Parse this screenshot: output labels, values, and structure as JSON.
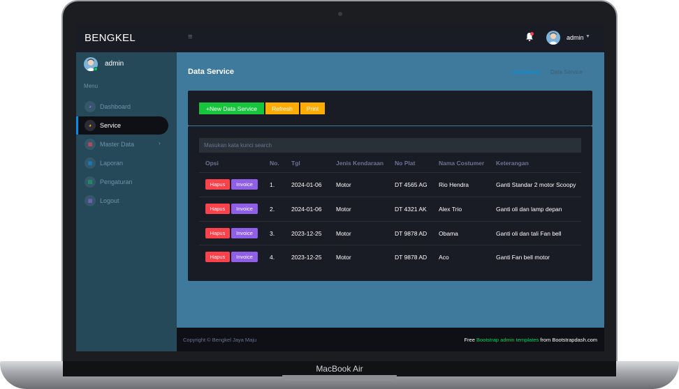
{
  "device": {
    "label": "MacBook Air"
  },
  "topbar": {
    "brand": "BENGKEL",
    "menu_icon": "hamburger-icon",
    "user": "admin"
  },
  "sidebar": {
    "user": "admin",
    "menu_title": "Menu",
    "items": [
      {
        "label": "Dashboard",
        "icon": "speedometer-icon",
        "color": "#8f5fe8"
      },
      {
        "label": "Service",
        "icon": "gauge-icon",
        "color": "#ffab00",
        "active": true
      },
      {
        "label": "Master Data",
        "icon": "laptop-icon",
        "color": "#fc424a"
      },
      {
        "label": "Laporan",
        "icon": "table-icon",
        "color": "#0090e7"
      },
      {
        "label": "Pengaturan",
        "icon": "chart-icon",
        "color": "#00d25b"
      },
      {
        "label": "Logout",
        "icon": "logout-icon",
        "color": "#8f5fe8"
      }
    ]
  },
  "page": {
    "title": "Data Service",
    "breadcrumb": [
      "Dashboard",
      "Data Service"
    ]
  },
  "toolbar": {
    "new": "+New Data Service",
    "refresh": "Refresh",
    "print": "Print"
  },
  "search": {
    "placeholder": "Masukan kata kunci search"
  },
  "table": {
    "headers": [
      "Opsi",
      "No.",
      "Tgl",
      "Jenis Kendaraan",
      "No Plat",
      "Nama Costumer",
      "Keterangan"
    ],
    "action_labels": {
      "hapus": "Hapus",
      "invoice": "Invoice"
    },
    "rows": [
      {
        "no": "1.",
        "tgl": "2024-01-06",
        "jenis": "Motor",
        "plat": "DT 4565 AG",
        "nama": "Rio Hendra",
        "ket": "Ganti Standar 2 motor Scoopy"
      },
      {
        "no": "2.",
        "tgl": "2024-01-06",
        "jenis": "Motor",
        "plat": "DT 4321 AK",
        "nama": "Alex Trio",
        "ket": "Ganti oli dan lamp depan"
      },
      {
        "no": "3.",
        "tgl": "2023-12-25",
        "jenis": "Motor",
        "plat": "DT 9878 AD",
        "nama": "Obama",
        "ket": "Ganti oli dan tali Fan bell"
      },
      {
        "no": "4.",
        "tgl": "2023-12-25",
        "jenis": "Motor",
        "plat": "DT 9878 AD",
        "nama": "Aco",
        "ket": "Ganti Fan bell motor"
      }
    ]
  },
  "footer": {
    "copyright": "Copyright © Bengkel Jaya Maju",
    "free_prefix": "Free ",
    "free_link": "Bootstrap admin templates",
    "free_suffix": " from Bootstrapdash.com"
  }
}
